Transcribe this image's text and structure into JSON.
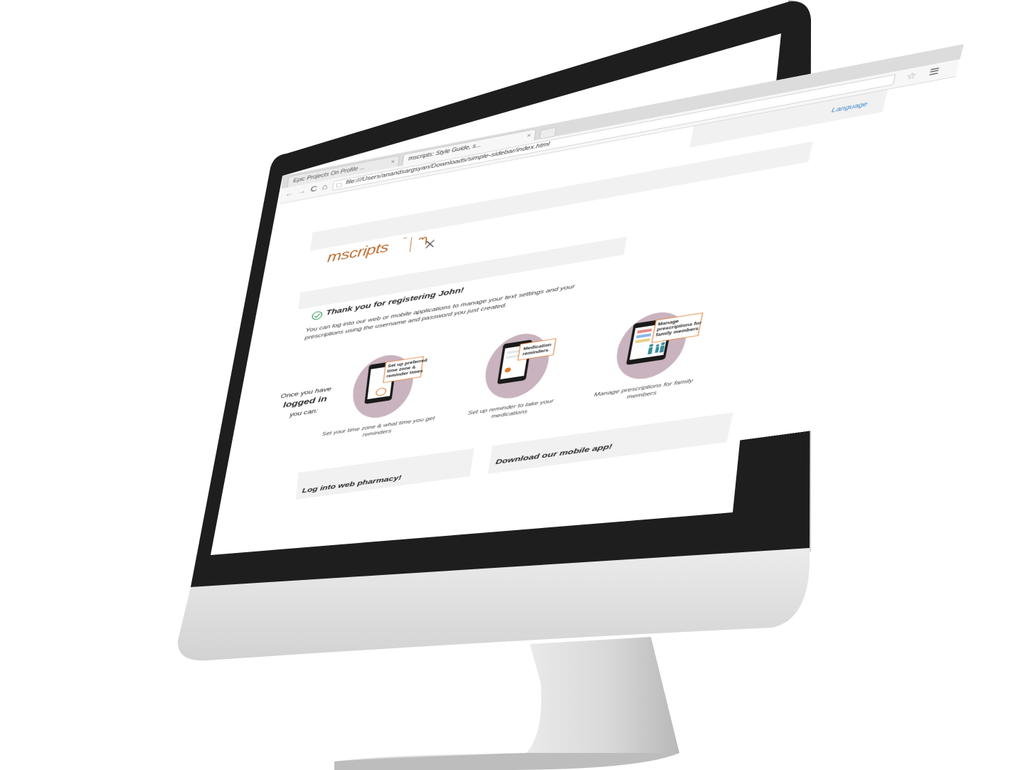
{
  "browser": {
    "tabs": [
      {
        "label": "Epic Projects On Profile ..."
      },
      {
        "label": "mscripts: Style Guide, s..."
      }
    ],
    "tab_close": "×",
    "url": "file:///Users/anandsargsyan/Downloads/simple-sidebar/index.html",
    "nav": {
      "back": "←",
      "forward": "→",
      "reload": "C",
      "home": "⌂"
    },
    "bookmark_icon": "star-icon",
    "menu_icon": "menu-icon"
  },
  "page": {
    "language_link": "Language",
    "logo": {
      "wordmark": "mscripts",
      "tm": "™",
      "mark": "mx"
    },
    "thanks_title": "Thank you for registering John!",
    "thanks_body": "You can log into our web or mobile applications to manage your text settings and your prescriptions using the username and password you just created.",
    "once": {
      "line1": "Once you have",
      "line2": "logged in",
      "line3": "you can:"
    },
    "features": [
      {
        "bubble": [
          "Set up preferred",
          "time zone &",
          "reminder times"
        ],
        "caption": "Set your time zone & what time you get reminders"
      },
      {
        "bubble": [
          "Medication",
          "reminders"
        ],
        "caption": "Set up reminder to take your medications"
      },
      {
        "bubble": [
          "Manage",
          "prescriptions for",
          "family members"
        ],
        "caption": "Manage prescriptions for family members"
      }
    ],
    "cards": [
      {
        "title": "Log into web pharmacy!"
      },
      {
        "title": "Download our mobile app!"
      }
    ]
  },
  "colors": {
    "brand_orange": "#b86a2e",
    "link_blue": "#3a86c8",
    "check_green": "#2e9c5a",
    "illustration_circle": "#c9b3be",
    "bezel": "#1e1e1e",
    "chin": "#e2e2e2"
  }
}
